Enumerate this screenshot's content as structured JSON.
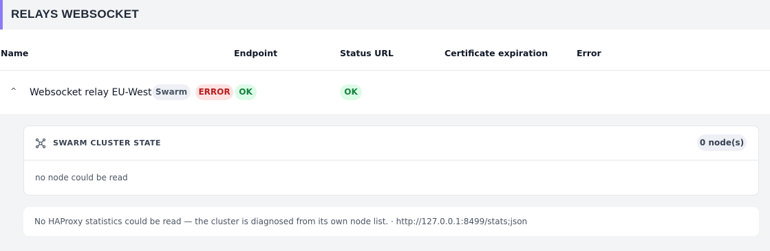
{
  "section": {
    "title": "RELAYS WEBSOCKET",
    "accent_color": "#8b7cf6"
  },
  "table": {
    "columns": [
      "Name",
      "Endpoint",
      "Status URL",
      "Certificate expiration",
      "Error"
    ]
  },
  "relay": {
    "expand_icon": "chevron-up-icon",
    "name": "Websocket relay EU-West",
    "type_badge": "Swarm",
    "endpoint_status": "ERROR",
    "endpoint_ok": "OK",
    "status_url_state": "OK",
    "certificate_expiration": "",
    "error": ""
  },
  "cluster": {
    "icon": "cluster-icon",
    "title": "SWARM CLUSTER STATE",
    "node_count": "0 node(s)",
    "empty_text": "no node could be read"
  },
  "note": {
    "text": "No HAProxy statistics could be read — the cluster is diagnosed from its own node list. · http://127.0.0.1:8499/stats;json"
  },
  "colors": {
    "error_bg": "#fde2e2",
    "error_fg": "#b91c1c",
    "ok_bg": "#dcfce7",
    "ok_fg": "#15803d",
    "neutral_bg": "#eef0f6"
  }
}
